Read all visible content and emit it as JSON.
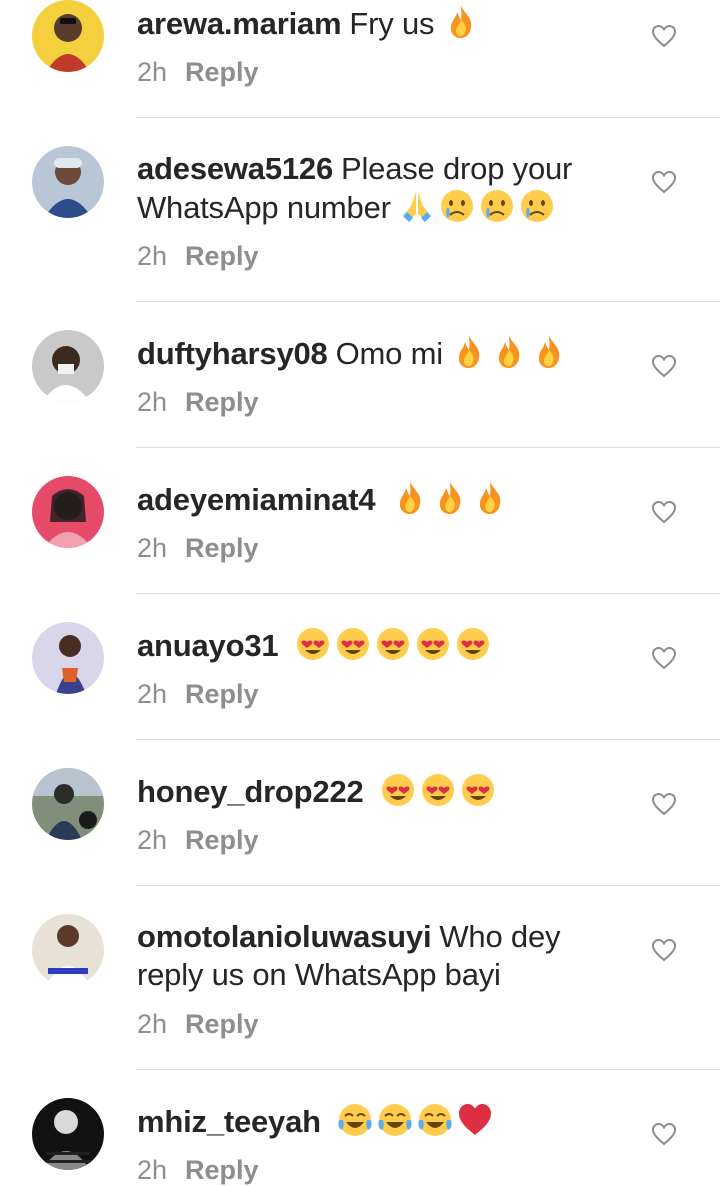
{
  "comments": [
    {
      "username": "arewa.mariam",
      "text": "Fry us",
      "time": "2h",
      "reply": "Reply",
      "emojis": [
        "fire"
      ]
    },
    {
      "username": "adesewa5126",
      "text": "Please drop your WhatsApp number",
      "time": "2h",
      "reply": "Reply",
      "emojis": [
        "folded-hands",
        "crying-face",
        "crying-face",
        "crying-face"
      ]
    },
    {
      "username": "duftyharsy08",
      "text": "Omo mi",
      "time": "2h",
      "reply": "Reply",
      "emojis": [
        "fire",
        "fire",
        "fire"
      ]
    },
    {
      "username": "adeyemiaminat4",
      "text": "",
      "time": "2h",
      "reply": "Reply",
      "emojis": [
        "fire",
        "fire",
        "fire"
      ]
    },
    {
      "username": "anuayo31",
      "text": "",
      "time": "2h",
      "reply": "Reply",
      "emojis": [
        "heart-eyes",
        "heart-eyes",
        "heart-eyes",
        "heart-eyes",
        "heart-eyes"
      ]
    },
    {
      "username": "honey_drop222",
      "text": "",
      "time": "2h",
      "reply": "Reply",
      "emojis": [
        "heart-eyes",
        "heart-eyes",
        "heart-eyes"
      ]
    },
    {
      "username": "omotolanioluwasuyi",
      "text": "Who dey reply us on WhatsApp bayi",
      "time": "2h",
      "reply": "Reply",
      "emojis": []
    },
    {
      "username": "mhiz_teeyah",
      "text": "",
      "time": "2h",
      "reply": "Reply",
      "emojis": [
        "tears-of-joy",
        "tears-of-joy",
        "tears-of-joy",
        "red-heart"
      ]
    }
  ],
  "icons": {
    "like": "heart-outline-icon"
  },
  "colors": {
    "text": "#262626",
    "meta": "#8e8e8e",
    "divider": "#dbdbdb"
  }
}
